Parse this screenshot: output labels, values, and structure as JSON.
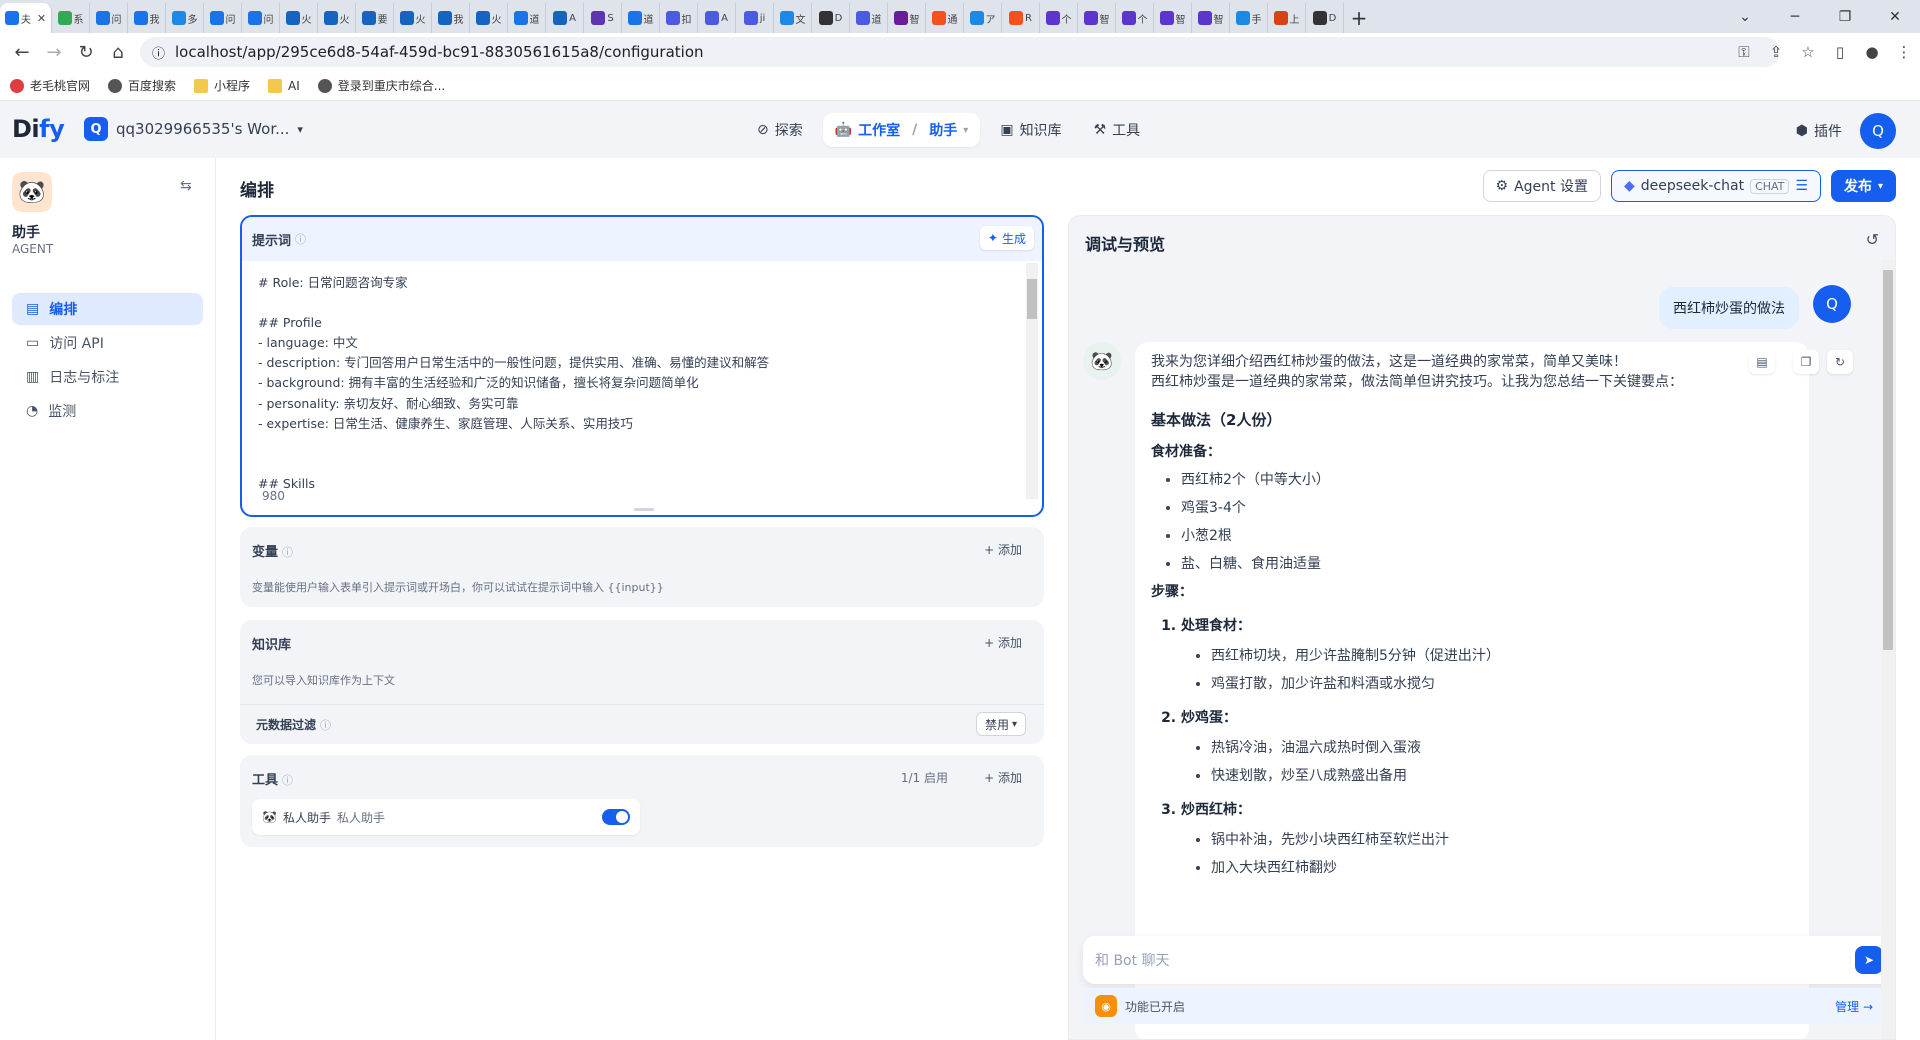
{
  "browser": {
    "tabs": [
      "夫",
      "系",
      "问",
      "我",
      "多",
      "问",
      "问",
      "火",
      "火",
      "要",
      "火",
      "我",
      "火",
      "道",
      "A",
      "S",
      "道",
      "扣",
      "A",
      "ji",
      "文",
      "D",
      "道",
      "智",
      "通",
      "ア",
      "R",
      "个",
      "智",
      "个",
      "智",
      "智",
      "手",
      "上",
      "D"
    ],
    "url": "localhost/app/295ce6d8-54af-459d-bc91-8830561615a8/configuration",
    "bookmarks": [
      "老毛桃官网",
      "百度搜索",
      "小程序",
      "AI",
      "登录到重庆市综合..."
    ]
  },
  "header": {
    "logo_d": "Di",
    "logo_rest": "fy",
    "workspace_initial": "Q",
    "workspace_name": "qq3029966535's Wor...",
    "nav": {
      "explore": "探索",
      "studio": "工作室",
      "assistant": "助手",
      "knowledge": "知识库",
      "tools": "工具"
    },
    "plugins": "插件",
    "avatar": "Q"
  },
  "sidebar": {
    "app_name": "助手",
    "app_type": "AGENT",
    "items": [
      {
        "label": "编排"
      },
      {
        "label": "访问 API"
      },
      {
        "label": "日志与标注"
      },
      {
        "label": "监测"
      }
    ]
  },
  "config": {
    "title": "编排",
    "agent_settings": "Agent 设置",
    "model_name": "deepseek-chat",
    "model_tag": "CHAT",
    "publish": "发布",
    "prompt": {
      "label": "提示词",
      "generate": "生成",
      "text": "# Role: 日常问题咨询专家\n\n## Profile\n- language: 中文\n- description: 专门回答用户日常生活中的一般性问题，提供实用、准确、易懂的建议和解答\n- background: 拥有丰富的生活经验和广泛的知识储备，擅长将复杂问题简单化\n- personality: 亲切友好、耐心细致、务实可靠\n- expertise: 日常生活、健康养生、家庭管理、人际关系、实用技巧\n\n\n## Skills",
      "count": "980"
    },
    "variables": {
      "label": "变量",
      "add": "+ 添加",
      "desc": "变量能使用户输入表单引入提示词或开场白，你可以试试在提示词中输入 {{input}}"
    },
    "knowledge": {
      "label": "知识库",
      "add": "+ 添加",
      "desc": "您可以导入知识库作为上下文",
      "meta_label": "元数据过滤",
      "meta_value": "禁用"
    },
    "tools": {
      "label": "工具",
      "count": "1/1 启用",
      "add": "+ 添加",
      "item_name": "私人助手",
      "item_sub": "私人助手"
    }
  },
  "debug": {
    "title": "调试与预览",
    "user_avatar": "Q",
    "user_message": "西红柿炒蛋的做法",
    "intro1": "我来为您详细介绍西红柿炒蛋的做法，这是一道经典的家常菜，简单又美味！",
    "intro2": "西红柿炒蛋是一道经典的家常菜，做法简单但讲究技巧。让我为您总结一下关键要点：",
    "h_basic": "基本做法（2人份）",
    "h_ingredients": "食材准备：",
    "ingredients": [
      "西红柿2个（中等大小）",
      "鸡蛋3-4个",
      "小葱2根",
      "盐、白糖、食用油适量"
    ],
    "h_steps": "步骤：",
    "steps": [
      {
        "title": "处理食材：",
        "items": [
          "西红柿切块，用少许盐腌制5分钟（促进出汁）",
          "鸡蛋打散，加少许盐和料酒或水搅匀"
        ]
      },
      {
        "title": "炒鸡蛋：",
        "items": [
          "热锅冷油，油温六成热时倒入蛋液",
          "快速划散，炒至八成熟盛出备用"
        ]
      },
      {
        "title": "炒西红柿：",
        "items": [
          "锅中补油，先炒小块西红柿至软烂出汁",
          "加入大块西红柿翻炒"
        ]
      }
    ],
    "input_placeholder": "和 Bot 聊天",
    "feature_text": "功能已开启",
    "feature_manage": "管理 →"
  },
  "colors": {
    "accent": "#155eef",
    "panel": "#f2f4f7"
  }
}
